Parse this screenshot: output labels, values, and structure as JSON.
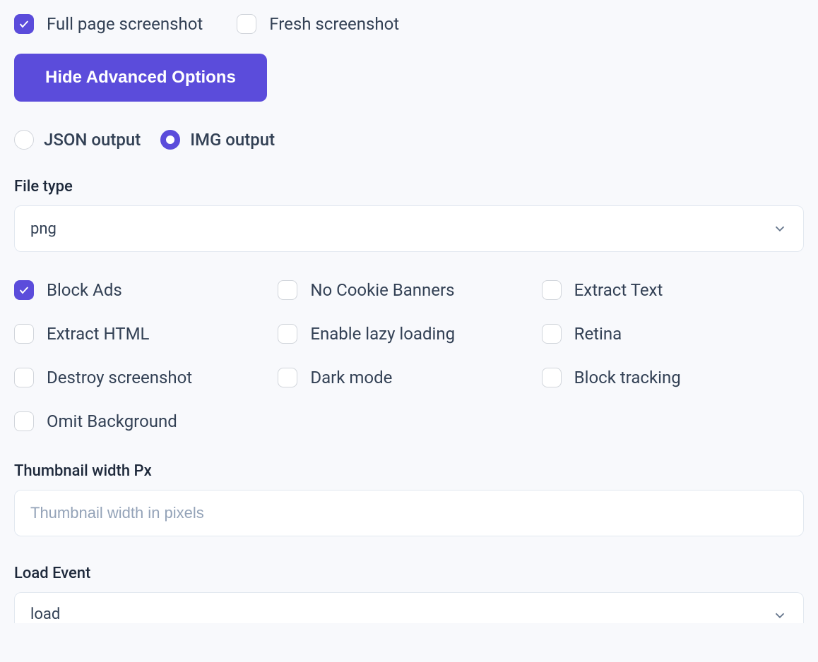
{
  "topOptions": {
    "fullPage": {
      "label": "Full page screenshot",
      "checked": true
    },
    "fresh": {
      "label": "Fresh screenshot",
      "checked": false
    }
  },
  "advancedButton": "Hide Advanced Options",
  "outputMode": {
    "json": "JSON output",
    "img": "IMG output",
    "selected": "img"
  },
  "fileType": {
    "label": "File type",
    "value": "png"
  },
  "flags": {
    "blockAds": {
      "label": "Block Ads",
      "checked": true
    },
    "noCookieBanners": {
      "label": "No Cookie Banners",
      "checked": false
    },
    "extractText": {
      "label": "Extract Text",
      "checked": false
    },
    "extractHtml": {
      "label": "Extract HTML",
      "checked": false
    },
    "enableLazyLoading": {
      "label": "Enable lazy loading",
      "checked": false
    },
    "retina": {
      "label": "Retina",
      "checked": false
    },
    "destroyScreenshot": {
      "label": "Destroy screenshot",
      "checked": false
    },
    "darkMode": {
      "label": "Dark mode",
      "checked": false
    },
    "blockTracking": {
      "label": "Block tracking",
      "checked": false
    },
    "omitBackground": {
      "label": "Omit Background",
      "checked": false
    }
  },
  "thumbnailWidth": {
    "label": "Thumbnail width Px",
    "placeholder": "Thumbnail width in pixels",
    "value": ""
  },
  "loadEvent": {
    "label": "Load Event",
    "value": "load"
  }
}
